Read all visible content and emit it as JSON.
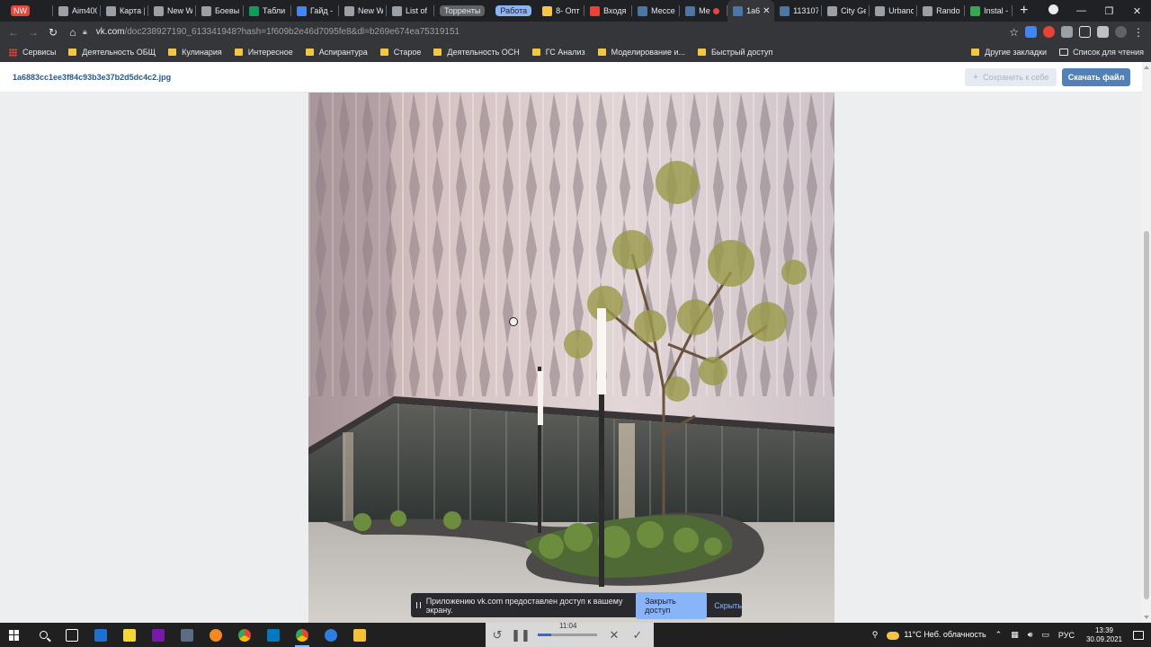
{
  "browser": {
    "tabs": [
      {
        "title": "",
        "badge": "NW",
        "badge_color": "#e8453c"
      },
      {
        "title": "Aim400",
        "icon_color": "#9aa0a6"
      },
      {
        "title": "Карта |",
        "icon_color": "#9aa0a6"
      },
      {
        "title": "New W",
        "icon_color": "#9aa0a6"
      },
      {
        "title": "Боевы",
        "icon_color": "#9aa0a6"
      },
      {
        "title": "Табли",
        "icon_color": "#0f9d58"
      },
      {
        "title": "Гайд -",
        "icon_color": "#4285f4"
      },
      {
        "title": "New W",
        "icon_color": "#9aa0a6"
      },
      {
        "title": "List of",
        "icon_color": "#9aa0a6"
      }
    ],
    "group_torrents": "Торренты",
    "group_work": "Работа",
    "tabs_group2": [
      {
        "title": "8- Опт",
        "icon_color": "#f6c544"
      },
      {
        "title": "Входя",
        "icon_color": "#ea4335"
      },
      {
        "title": "Мессе",
        "icon_color": "#4a76a8"
      },
      {
        "title": "Ме",
        "icon_color": "#4a76a8"
      }
    ],
    "active_tab": {
      "title": "1a6",
      "icon_color": "#4a76a8"
    },
    "tabs_group3": [
      {
        "title": "113107",
        "icon_color": "#4a76a8"
      },
      {
        "title": "City Ge",
        "icon_color": "#9aa0a6"
      },
      {
        "title": "Urbano",
        "icon_color": "#9aa0a6"
      },
      {
        "title": "Rando",
        "icon_color": "#9aa0a6"
      },
      {
        "title": "Instal -",
        "icon_color": "#34a853"
      }
    ],
    "new_tab": "+",
    "url_host": "vk.com",
    "url_rest": "/doc238927190_613341948?hash=1f609b2e46d7095fe8&dl=b269e674ea75319151"
  },
  "bookmarks": {
    "items": [
      "Сервисы",
      "Деятельность ОБЩ",
      "Кулинария",
      "Интересное",
      "Аспирантура",
      "Старое",
      "Деятельность ОСН",
      "ГС Анализ",
      "Моделирование и...",
      "Быстрый доступ"
    ],
    "other": "Другие закладки",
    "reading_list": "Список для чтения"
  },
  "doc": {
    "filename": "1a6883cc1ee3f84c93b3e37b2d5dc4c2.jpg",
    "save_label": "Сохранить к себе",
    "download_label": "Скачать файл"
  },
  "share_banner": {
    "message": "Приложению vk.com предоставлен доступ к вашему экрану.",
    "stop_label": "Закрыть доступ",
    "hide_label": "Скрыть"
  },
  "recorder": {
    "time": "11:04",
    "progress": 0.22
  },
  "tray": {
    "temperature": "11°C",
    "weather": "Неб. облачность",
    "language": "РУС",
    "time": "13:39",
    "date": "30.09.2021"
  }
}
